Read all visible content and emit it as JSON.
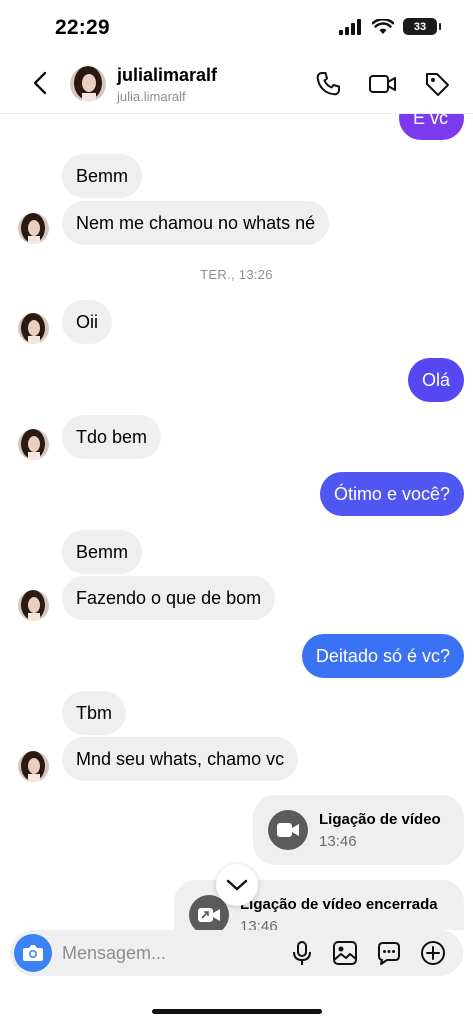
{
  "status_bar": {
    "time": "22:29",
    "battery": "33"
  },
  "header": {
    "name": "julialimaralf",
    "handle": "julia.limaralf"
  },
  "colors": {
    "outgoing_purple": "#7c3aed",
    "outgoing_mid": "#5b50f0",
    "outgoing_blue": "#3b82f6",
    "incoming": "#efefef"
  },
  "messages": {
    "m0": "É vc",
    "m1": "Bemm",
    "m2": "Nem me chamou no whats né",
    "timestamp": "TER., 13:26",
    "m3": "Oii",
    "m4": "Olá",
    "m5": "Tdo bem",
    "m6": "Ótimo e você?",
    "m7": "Bemm",
    "m8": "Fazendo o que de bom",
    "m9": "Deitado só é vc?",
    "m10": "Tbm",
    "m11": "Mnd seu whats, chamo vc"
  },
  "calls": [
    {
      "title": "Ligação de vídeo",
      "time": "13:46"
    },
    {
      "title": "Ligação de vídeo encerrada",
      "time": "13:46"
    }
  ],
  "composer": {
    "placeholder": "Mensagem..."
  },
  "icons": [
    "back-icon",
    "phone-icon",
    "video-icon",
    "tag-icon",
    "camera-icon",
    "microphone-icon",
    "image-icon",
    "sticker-icon",
    "plus-icon",
    "chevron-down-icon"
  ]
}
